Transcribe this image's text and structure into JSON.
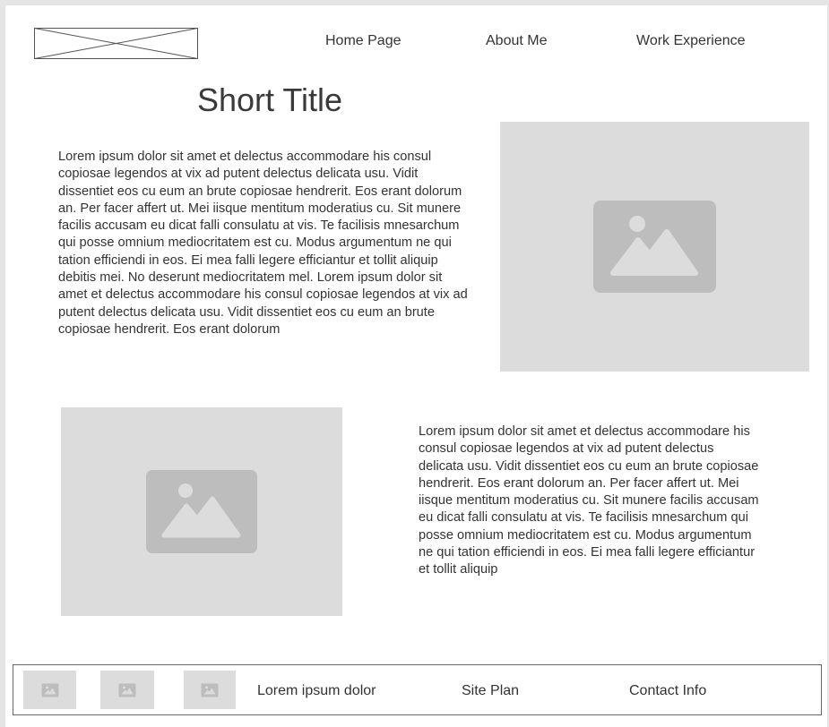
{
  "header": {
    "logo_icon": "logo-placeholder-icon",
    "nav": [
      {
        "label": "Home Page"
      },
      {
        "label": "About Me"
      },
      {
        "label": "Work Experience"
      }
    ]
  },
  "main": {
    "title": "Short Title",
    "section1_text": "Lorem ipsum dolor sit amet et delectus accommodare his consul copiosae legendos at vix ad putent delectus delicata usu. Vidit dissentiet eos cu eum an brute copiosae hendrerit. Eos erant dolorum an. Per facer affert ut. Mei iisque mentitum moderatius cu. Sit munere facilis accusam eu dicat falli consulatu at vis. Te facilisis mnesarchum qui posse omnium mediocritatem est cu. Modus argumentum ne qui tation efficiendi in eos. Ei mea falli legere efficiantur et tollit aliquip debitis mei. No deserunt mediocritatem mel. Lorem ipsum dolor sit amet et delectus accommodare his consul copiosae legendos at vix ad putent delectus delicata usu. Vidit dissentiet eos cu eum an brute copiosae hendrerit. Eos erant dolorum",
    "section2_text": "Lorem ipsum dolor sit amet et delectus accommodare his consul copiosae legendos at vix ad putent delectus delicata usu. Vidit dissentiet eos cu eum an brute copiosae hendrerit. Eos erant dolorum an. Per facer affert ut. Mei iisque mentitum moderatius cu. Sit munere facilis accusam eu dicat falli consulatu at vis. Te facilisis mnesarchum qui posse omnium mediocritatem est cu. Modus argumentum ne qui tation efficiendi in eos. Ei mea falli legere efficiantur et tollit aliquip",
    "image_icon": "image-placeholder-icon"
  },
  "footer": {
    "links": [
      {
        "label": "Lorem ipsum dolor"
      },
      {
        "label": "Site Plan"
      },
      {
        "label": "Contact Info"
      }
    ]
  },
  "colors": {
    "placeholder_bg": "#dcdcdc",
    "placeholder_icon": "#bdbdbd",
    "text": "#333333",
    "page_bg": "#ffffff"
  }
}
